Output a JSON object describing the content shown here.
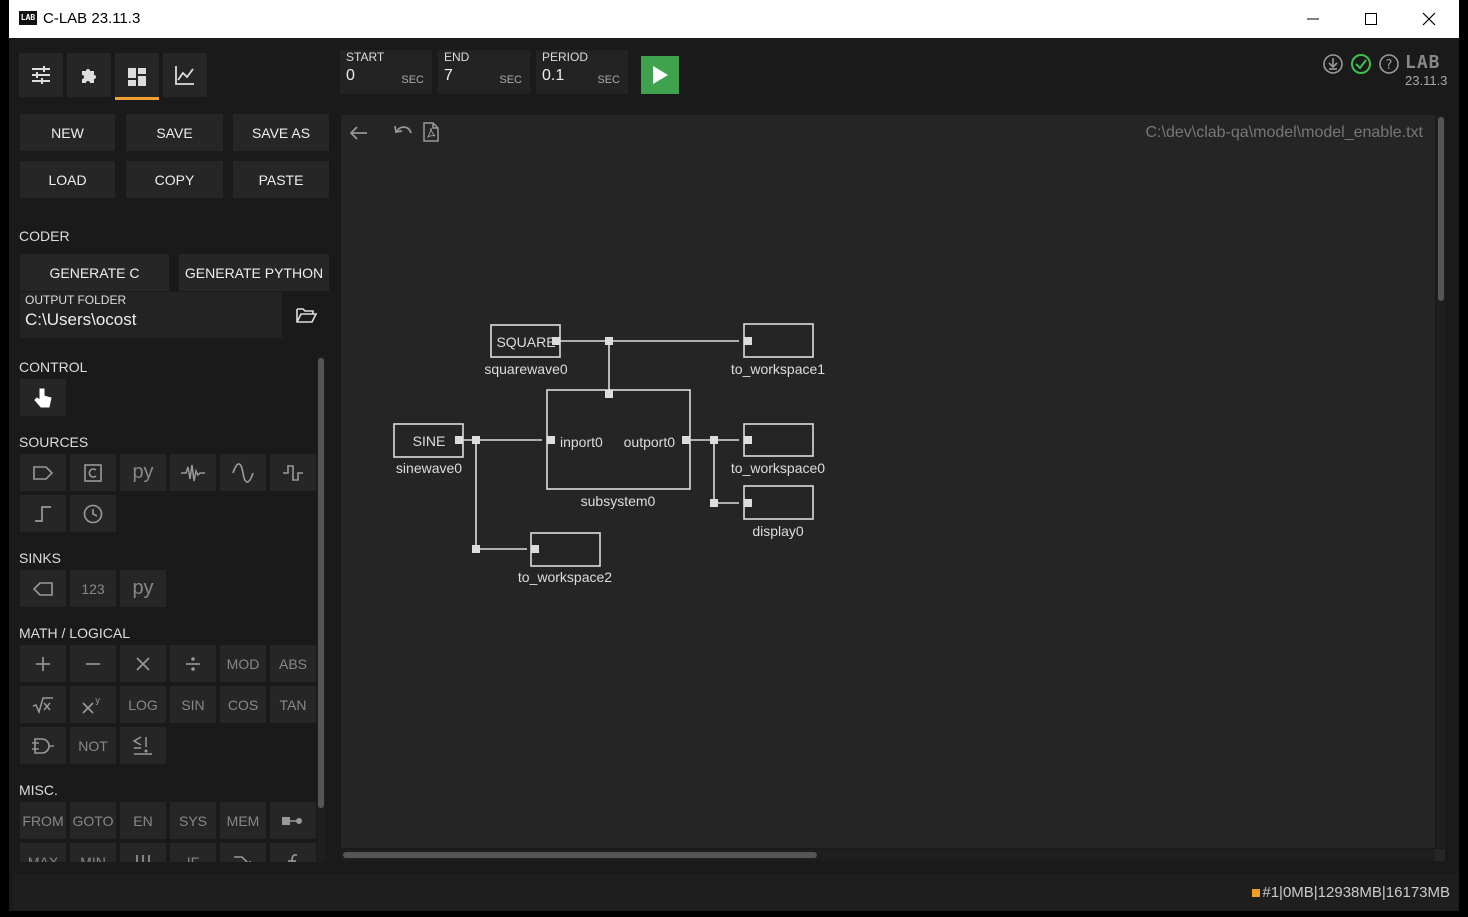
{
  "window": {
    "title": "C-LAB 23.11.3",
    "logo": "LAB"
  },
  "tabs": [
    {
      "icon": "sliders-icon"
    },
    {
      "icon": "puzzle-icon"
    },
    {
      "icon": "dashboard-icon"
    },
    {
      "icon": "chart-icon"
    }
  ],
  "sim": {
    "start": {
      "label": "START",
      "value": "0",
      "unit": "SEC"
    },
    "end": {
      "label": "END",
      "value": "7",
      "unit": "SEC"
    },
    "period": {
      "label": "PERIOD",
      "value": "0.1",
      "unit": "SEC"
    }
  },
  "brand": {
    "logo": "LAB",
    "version": "23.11.3"
  },
  "file_buttons": {
    "new": "NEW",
    "save": "SAVE",
    "save_as": "SAVE AS",
    "load": "LOAD",
    "copy": "COPY",
    "paste": "PASTE"
  },
  "coder": {
    "title": "CODER",
    "generate_c": "GENERATE C",
    "generate_python": "GENERATE PYTHON",
    "output_label": "OUTPUT FOLDER",
    "output_value": "C:\\Users\\ocost"
  },
  "palette": {
    "control": "CONTROL",
    "sources": "SOURCES",
    "sinks": "SINKS",
    "sinks_items": [
      "123",
      "py"
    ],
    "sources_py": "py",
    "math": "MATH / LOGICAL",
    "math_items": [
      "MOD",
      "ABS",
      "LOG",
      "SIN",
      "COS",
      "TAN",
      "NOT"
    ],
    "misc": "MISC.",
    "misc_items": [
      "FROM",
      "GOTO",
      "EN",
      "SYS",
      "MEM",
      "MAX",
      "MIN",
      "IF"
    ]
  },
  "canvas": {
    "filepath": "C:\\dev\\clab-qa\\model\\model_enable.txt",
    "blocks": {
      "square": {
        "text": "SQUARE",
        "name": "squarewave0"
      },
      "sine": {
        "text": "SINE",
        "name": "sinewave0"
      },
      "ws1": {
        "name": "to_workspace1"
      },
      "ws0": {
        "name": "to_workspace0"
      },
      "disp": {
        "name": "display0"
      },
      "ws2": {
        "name": "to_workspace2"
      },
      "subsystem": {
        "name": "subsystem0",
        "inport": "inport0",
        "outport": "outport0"
      }
    }
  },
  "status": {
    "text": "#1|0MB|12938MB|16173MB"
  },
  "colors": {
    "accent": "#f0a030",
    "run": "#3fa34d",
    "ok": "#3fbf4f"
  }
}
